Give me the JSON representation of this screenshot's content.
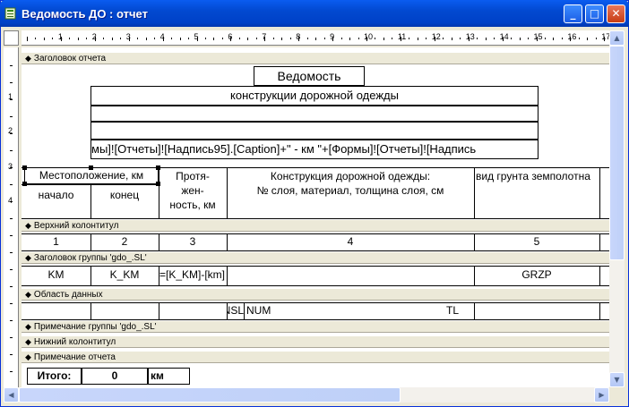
{
  "window": {
    "title": "Ведомость ДО : отчет",
    "min_glyph": "_",
    "max_glyph": "□",
    "close_glyph": "✕"
  },
  "ruler": {
    "h_marks": [
      "1",
      "2",
      "3",
      "4",
      "5",
      "6",
      "7",
      "8",
      "9",
      "10",
      "11",
      "12",
      "13",
      "14",
      "15",
      "16",
      "17"
    ],
    "v_marks": [
      "1",
      "2",
      "3",
      "4"
    ]
  },
  "bands": {
    "report_header": "Заголовок отчета",
    "page_header": "Верхний колонтитул",
    "group_header": "Заголовок группы 'gdo_.SL'",
    "detail": "Область данных",
    "group_footer": "Примечание группы 'gdo_.SL'",
    "page_footer": "Нижний колонтитул",
    "report_footer": "Примечание отчета"
  },
  "report_header": {
    "title": "Ведомость",
    "subtitle": "конструкции дорожной одежды",
    "expr": "мы]![Отчеты]![Надпись95].[Caption]+\" - км \"+[Формы]![Отчеты]![Надпись",
    "col_location": "Местоположение, км",
    "col_start": "начало",
    "col_end": "конец",
    "col_length_1": "Протя-",
    "col_length_2": "жен-",
    "col_length_3": "ность, км",
    "col_construction_1": "Конструкция дорожной одежды:",
    "col_construction_2": "№ слоя, материал, толщина слоя, см",
    "col_soil": "вид грунта земполотна"
  },
  "page_header": {
    "n1": "1",
    "n2": "2",
    "n3": "3",
    "n4": "4",
    "n5": "5"
  },
  "group_header": {
    "km": "KM",
    "k_km": "K_KM",
    "length": "=[K_KM]-[km]",
    "grzp": "GRZP"
  },
  "detail": {
    "nsl": "NSL",
    "num": "NUM",
    "tl": "TL"
  },
  "report_footer": {
    "total_label": "Итого:",
    "total_value": "0",
    "unit": "км"
  }
}
